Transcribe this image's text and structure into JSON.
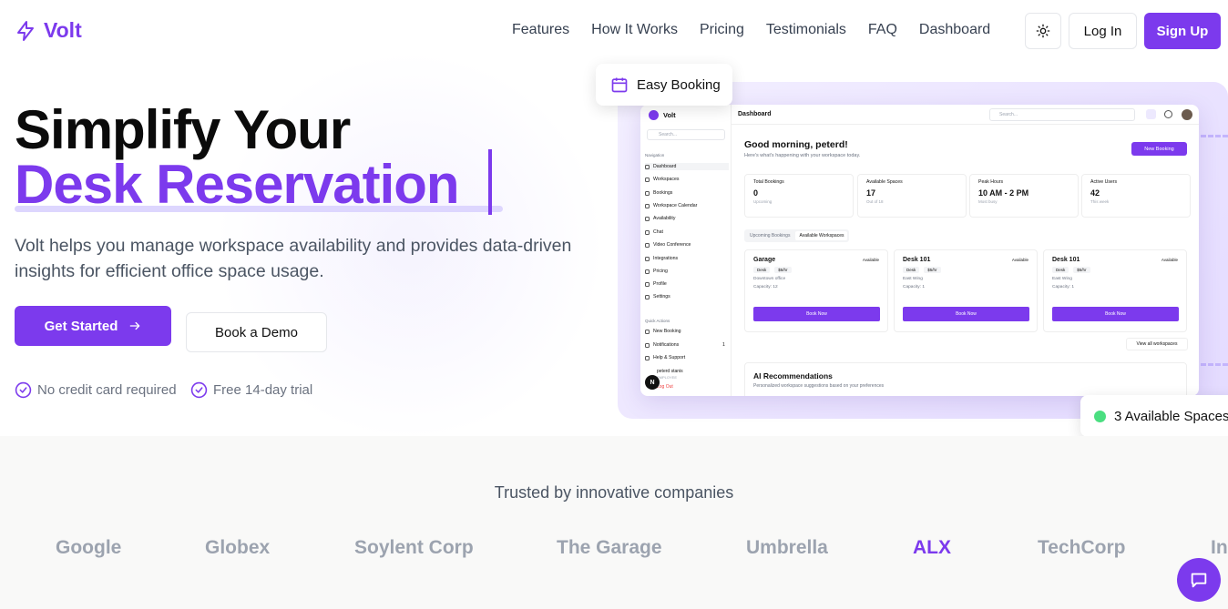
{
  "brand": {
    "name": "Volt",
    "accent": "#7c3aed"
  },
  "nav": [
    "Features",
    "How It Works",
    "Pricing",
    "Testimonials",
    "FAQ",
    "Dashboard"
  ],
  "header": {
    "login": "Log In",
    "signup": "Sign Up",
    "theme_icon": "sun-icon"
  },
  "hero": {
    "line1": "Simplify Your",
    "line2": "Desk Reservation",
    "subtitle": "Volt helps you manage workspace availability and provides data-driven insights for efficient office space usage.",
    "cta": "Get Started",
    "demo": "Book a Demo",
    "perks": [
      "No credit card required",
      "Free 14-day trial"
    ]
  },
  "floating": {
    "booking": "Easy Booking",
    "available": "3 Available Spaces"
  },
  "mock": {
    "logo": "Volt",
    "search": "Search...",
    "nav_section": "Navigation",
    "nav": [
      "Dashboard",
      "Workspaces",
      "Bookings",
      "Workspace Calendar",
      "Availability",
      "Chat",
      "Video Conference",
      "Integrations",
      "Pricing",
      "Profile",
      "Settings"
    ],
    "quick_section": "Quick Actions",
    "quick": [
      "New Booking",
      "Notifications",
      "Help & Support"
    ],
    "notif_count": "1",
    "user_name": "peterd stanis",
    "user_role": "EMPLOYEE",
    "logout": "Log Out",
    "avatar_initial": "N",
    "title": "Dashboard",
    "top_search": "Search...",
    "greeting": "Good morning, peterd!",
    "greeting_sub": "Here's what's happening with your workspace today.",
    "new_booking": "New Booking",
    "stats": [
      {
        "label": "Total Bookings",
        "value": "0",
        "sub": "Upcoming"
      },
      {
        "label": "Available Spaces",
        "value": "17",
        "sub": "Out of 18"
      },
      {
        "label": "Peak Hours",
        "value": "10 AM - 2 PM",
        "sub": "Most busy"
      },
      {
        "label": "Active Users",
        "value": "42",
        "sub": "This week"
      }
    ],
    "tabs": [
      "Upcoming Bookings",
      "Available Workspaces"
    ],
    "cards": [
      {
        "name": "Garage",
        "status": "Available",
        "type": "Desk",
        "price": "$5/hr",
        "location": "Downtown office",
        "capacity": "Capacity: 12",
        "button": "Book Now"
      },
      {
        "name": "Desk 101",
        "status": "Available",
        "type": "Desk",
        "price": "$5/hr",
        "location": "East Wing",
        "capacity": "Capacity: 1",
        "button": "Book Now"
      },
      {
        "name": "Desk 101",
        "status": "Available",
        "type": "Desk",
        "price": "$5/hr",
        "location": "East Wing",
        "capacity": "Capacity: 1",
        "button": "Book Now"
      }
    ],
    "view_all": "View all workspaces",
    "ai_title": "AI Recommendations",
    "ai_sub": "Personalized workspace suggestions based on your preferences"
  },
  "trusted": {
    "title": "Trusted by innovative companies",
    "companies": [
      "Google",
      "Globex",
      "Soylent Corp",
      "The Garage",
      "Umbrella",
      "ALX",
      "TechCorp",
      "In"
    ]
  },
  "chat_icon": "chat-icon"
}
